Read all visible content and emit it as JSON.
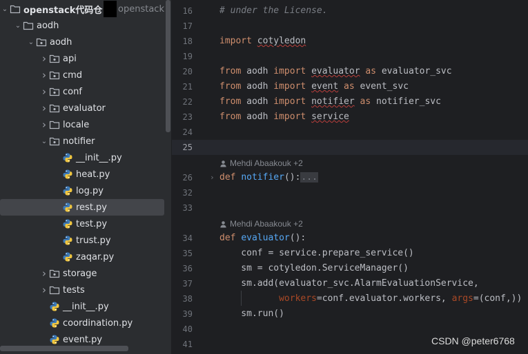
{
  "project_tree": {
    "project": {
      "name": "openstack代码仓",
      "path": "openstack"
    },
    "items": [
      {
        "label": "aodh",
        "depth": 1,
        "type": "folder",
        "open": true
      },
      {
        "label": "aodh",
        "depth": 2,
        "type": "package",
        "open": true
      },
      {
        "label": "api",
        "depth": 3,
        "type": "package",
        "open": false
      },
      {
        "label": "cmd",
        "depth": 3,
        "type": "package",
        "open": false
      },
      {
        "label": "conf",
        "depth": 3,
        "type": "package",
        "open": false
      },
      {
        "label": "evaluator",
        "depth": 3,
        "type": "package",
        "open": false
      },
      {
        "label": "locale",
        "depth": 3,
        "type": "folder",
        "open": false
      },
      {
        "label": "notifier",
        "depth": 3,
        "type": "package",
        "open": true
      },
      {
        "label": "__init__.py",
        "depth": 4,
        "type": "python"
      },
      {
        "label": "heat.py",
        "depth": 4,
        "type": "python"
      },
      {
        "label": "log.py",
        "depth": 4,
        "type": "python"
      },
      {
        "label": "rest.py",
        "depth": 4,
        "type": "python",
        "selected": true
      },
      {
        "label": "test.py",
        "depth": 4,
        "type": "python"
      },
      {
        "label": "trust.py",
        "depth": 4,
        "type": "python"
      },
      {
        "label": "zaqar.py",
        "depth": 4,
        "type": "python"
      },
      {
        "label": "storage",
        "depth": 3,
        "type": "package",
        "open": false
      },
      {
        "label": "tests",
        "depth": 3,
        "type": "folder",
        "open": false
      },
      {
        "label": "__init__.py",
        "depth": 3,
        "type": "python"
      },
      {
        "label": "coordination.py",
        "depth": 3,
        "type": "python"
      },
      {
        "label": "event.py",
        "depth": 3,
        "type": "python"
      }
    ]
  },
  "editor": {
    "current_line": "25",
    "lines": [
      {
        "n": "16",
        "tokens": [
          [
            "cm",
            "# under the License."
          ]
        ]
      },
      {
        "n": "17",
        "tokens": []
      },
      {
        "n": "18",
        "tokens": [
          [
            "kw",
            "import "
          ],
          [
            "sq",
            "cotyledon"
          ]
        ]
      },
      {
        "n": "19",
        "tokens": []
      },
      {
        "n": "20",
        "tokens": [
          [
            "kw",
            "from "
          ],
          [
            "",
            "aodh "
          ],
          [
            "kw",
            "import "
          ],
          [
            "sq",
            "evaluator"
          ],
          [
            "kw",
            " as "
          ],
          [
            "",
            "evaluator_svc"
          ]
        ]
      },
      {
        "n": "21",
        "tokens": [
          [
            "kw",
            "from "
          ],
          [
            "",
            "aodh "
          ],
          [
            "kw",
            "import "
          ],
          [
            "sq",
            "event"
          ],
          [
            "kw",
            " as "
          ],
          [
            "",
            "event_svc"
          ]
        ]
      },
      {
        "n": "22",
        "tokens": [
          [
            "kw",
            "from "
          ],
          [
            "",
            "aodh "
          ],
          [
            "kw",
            "import "
          ],
          [
            "sq",
            "notifier"
          ],
          [
            "kw",
            " as "
          ],
          [
            "",
            "notifier_svc"
          ]
        ]
      },
      {
        "n": "23",
        "tokens": [
          [
            "kw",
            "from "
          ],
          [
            "",
            "aodh "
          ],
          [
            "kw",
            "import "
          ],
          [
            "sq",
            "service"
          ]
        ]
      },
      {
        "n": "24",
        "tokens": []
      },
      {
        "n": "25",
        "tokens": []
      },
      {
        "author": "Mehdi Abaakouk +2"
      },
      {
        "n": "26",
        "fold": true,
        "tokens": [
          [
            "kw",
            "def "
          ],
          [
            "fn",
            "notifier"
          ],
          [
            "",
            "():"
          ],
          [
            "dots",
            "..."
          ]
        ]
      },
      {
        "n": "32",
        "tokens": []
      },
      {
        "n": "33",
        "tokens": []
      },
      {
        "author": "Mehdi Abaakouk +2"
      },
      {
        "n": "34",
        "tokens": [
          [
            "kw",
            "def "
          ],
          [
            "fn",
            "evaluator"
          ],
          [
            "",
            "():"
          ]
        ]
      },
      {
        "n": "35",
        "tokens": [
          [
            "",
            "    conf = service.prepare_service()"
          ]
        ]
      },
      {
        "n": "36",
        "tokens": [
          [
            "",
            "    sm = cotyledon.ServiceManager()"
          ]
        ]
      },
      {
        "n": "37",
        "tokens": [
          [
            "",
            "    sm.add(evaluator_svc.AlarmEvaluationService,"
          ]
        ]
      },
      {
        "n": "38",
        "tokens": [
          [
            "",
            "           "
          ],
          [
            "par",
            "workers"
          ],
          [
            "",
            "=conf.evaluator.workers, "
          ],
          [
            "par",
            "args"
          ],
          [
            "",
            "=(conf,))"
          ]
        ]
      },
      {
        "n": "39",
        "tokens": [
          [
            "",
            "    sm.run()"
          ]
        ]
      },
      {
        "n": "40",
        "tokens": []
      },
      {
        "n": "41",
        "tokens": []
      }
    ]
  },
  "watermark": "CSDN @peter6768"
}
